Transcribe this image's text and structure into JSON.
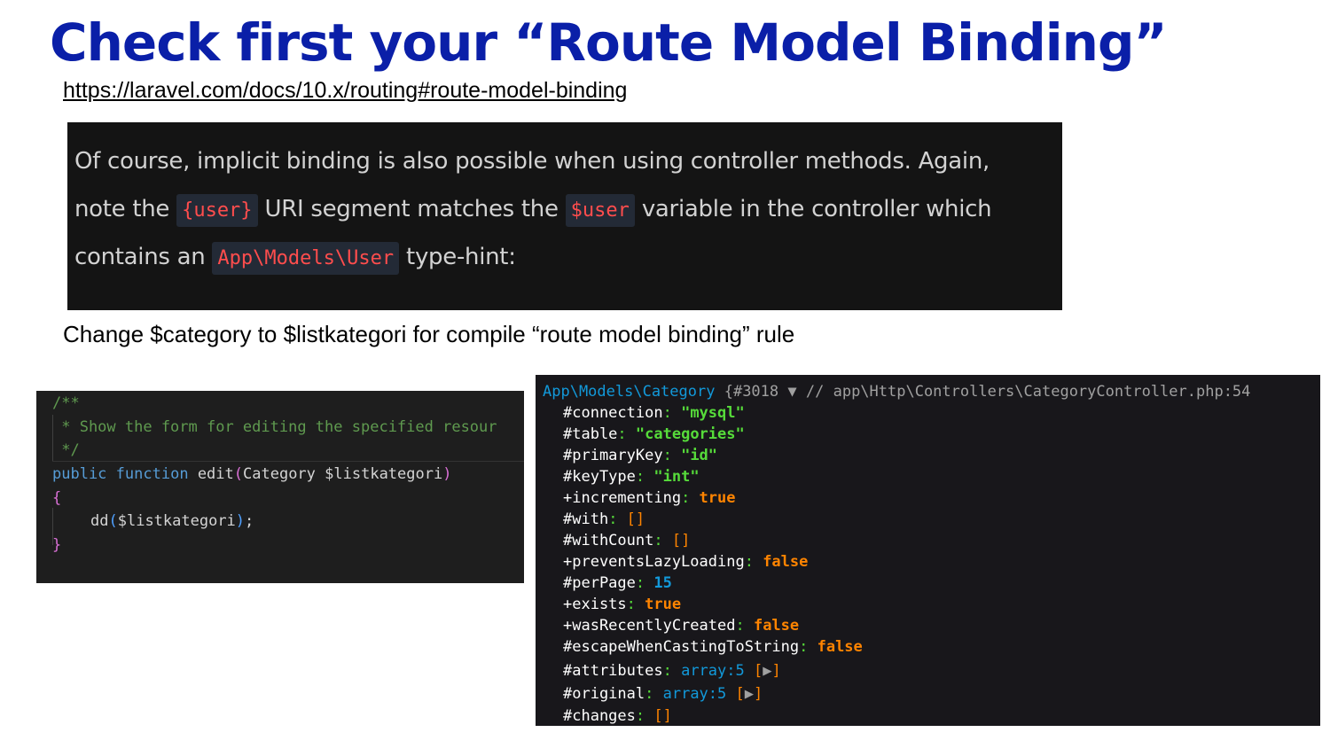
{
  "slide": {
    "title": "Check first your “Route Model Binding”",
    "link": "https://laravel.com/docs/10.x/routing#route-model-binding",
    "caption": "Change $category  to $listkategori for compile “route model binding” rule"
  },
  "doc_excerpt": {
    "line1": "Of course, implicit binding is also possible when using controller methods. Again,",
    "line2_pre": "note the ",
    "line2_code1": "{user}",
    "line2_mid": " URI segment matches the ",
    "line2_code2": "$user",
    "line2_post": " variable in the controller which",
    "line3_pre": "contains an ",
    "line3_code": "App\\Models\\User",
    "line3_post": " type-hint:"
  },
  "editor": {
    "comment_open": "/**",
    "comment_body": " * Show the form for editing the specified resour",
    "comment_close": " */",
    "kw_public": "public",
    "kw_function": "function",
    "fn_name": "edit",
    "paren_open": "(",
    "param_type": "Category",
    "param_name": "$listkategori",
    "paren_close": ")",
    "brace_open": "{",
    "call_fn": "dd",
    "call_paren_open": "(",
    "call_arg": "$listkategori",
    "call_paren_close": ")",
    "call_semicolon": ";",
    "brace_close": "}"
  },
  "dump": {
    "class_name": "App\\Models\\Category",
    "object_id": "{#3018",
    "toggle_icon": "▼",
    "source": "// app\\Http\\Controllers\\CategoryController.php:54",
    "rows": [
      {
        "key": "#connection",
        "value": "\"mysql\"",
        "kind": "str"
      },
      {
        "key": "#table",
        "value": "\"categories\"",
        "kind": "str"
      },
      {
        "key": "#primaryKey",
        "value": "\"id\"",
        "kind": "str"
      },
      {
        "key": "#keyType",
        "value": "\"int\"",
        "kind": "str"
      },
      {
        "key": "+incrementing",
        "value": "true",
        "kind": "bool"
      },
      {
        "key": "#with",
        "value": "[]",
        "kind": "arr"
      },
      {
        "key": "#withCount",
        "value": "[]",
        "kind": "arr"
      },
      {
        "key": "+preventsLazyLoading",
        "value": "false",
        "kind": "bool"
      },
      {
        "key": "#perPage",
        "value": "15",
        "kind": "num"
      },
      {
        "key": "+exists",
        "value": "true",
        "kind": "bool"
      },
      {
        "key": "+wasRecentlyCreated",
        "value": "false",
        "kind": "bool"
      },
      {
        "key": "#escapeWhenCastingToString",
        "value": "false",
        "kind": "bool"
      },
      {
        "key": "#attributes",
        "value": "array:5",
        "kind": "expand"
      },
      {
        "key": "#original",
        "value": "array:5",
        "kind": "expand"
      },
      {
        "key": "#changes",
        "value": "[]",
        "kind": "arr"
      }
    ],
    "expand_icon": "▶",
    "colors": {
      "string": "#56db3a",
      "bool": "#ff8400",
      "number": "#1299da",
      "class": "#1299da"
    }
  },
  "colors": {
    "title": "#0a1fa8",
    "doc_bg": "#141414",
    "inline_code": "#ff4d4d",
    "editor_bg": "#1e1e1e",
    "dump_bg": "#18171b"
  }
}
